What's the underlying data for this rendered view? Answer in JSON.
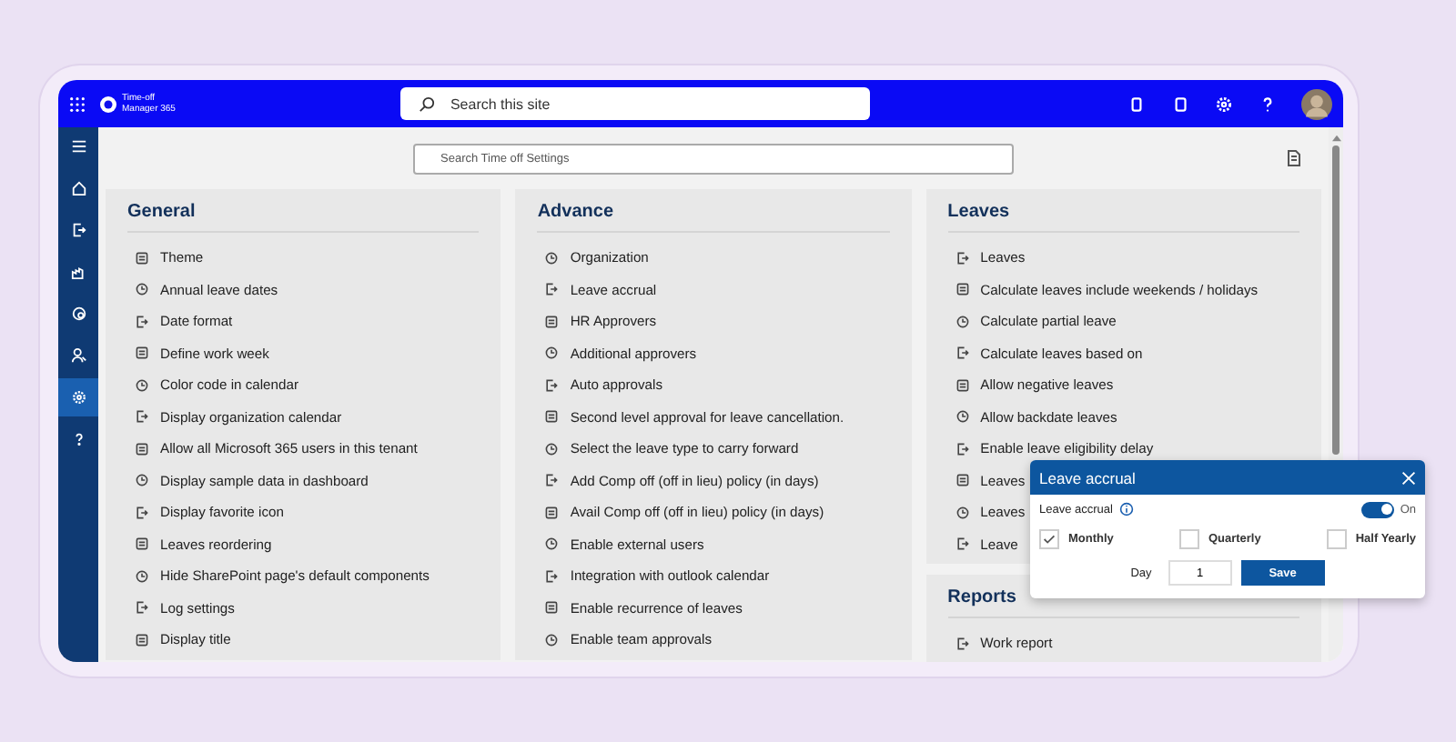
{
  "topbar": {
    "app_name_line1": "Time-off",
    "app_name_line2": "Manager 365",
    "search": {
      "placeholder": "Search this site"
    }
  },
  "rail": [
    {
      "selected": false
    },
    {
      "selected": false
    },
    {
      "selected": false
    },
    {
      "selected": false
    },
    {
      "selected": false
    },
    {
      "selected": false
    },
    {
      "selected": true
    },
    {
      "selected": false
    }
  ],
  "settings_search": {
    "placeholder": "Search Time off Settings"
  },
  "columns": [
    [
      {
        "title": "General",
        "items": [
          "Theme",
          "Annual leave dates",
          "Date format",
          "Define work week",
          "Color code in calendar",
          "Display organization calendar",
          "Allow all Microsoft 365 users in this tenant",
          "Display sample data in dashboard",
          "Display favorite icon",
          "Leaves reordering",
          "Hide SharePoint page's default components",
          "Log settings",
          "Display title"
        ]
      }
    ],
    [
      {
        "title": "Advance",
        "items": [
          "Organization",
          "Leave accrual",
          "HR Approvers",
          "Additional approvers",
          "Auto approvals",
          "Second level approval for leave cancellation.",
          "Select the leave type to carry forward",
          "Add Comp off (off in lieu) policy (in days)",
          "Avail Comp off (off in lieu) policy (in days)",
          "Enable external users",
          "Integration with outlook calendar",
          "Enable recurrence of leaves",
          "Enable team approvals"
        ]
      }
    ],
    [
      {
        "title": "Leaves",
        "items": [
          "Leaves",
          "Calculate leaves include weekends / holidays",
          "Calculate partial leave",
          "Calculate leaves based on",
          "Allow negative leaves",
          "Allow backdate leaves",
          "Enable leave eligibility delay",
          "Leaves",
          "Leaves",
          "Leave"
        ]
      },
      {
        "title": "Reports",
        "items": [
          "Work report"
        ]
      }
    ]
  ],
  "popup": {
    "title": "Leave accrual",
    "toggle": {
      "label": "Leave accrual",
      "on": true,
      "state_text": "On"
    },
    "options": [
      {
        "label": "Monthly",
        "checked": true
      },
      {
        "label": "Quarterly",
        "checked": false
      },
      {
        "label": "Half Yearly",
        "checked": false
      }
    ],
    "day": {
      "label": "Day",
      "value": "1"
    },
    "save": "Save"
  }
}
